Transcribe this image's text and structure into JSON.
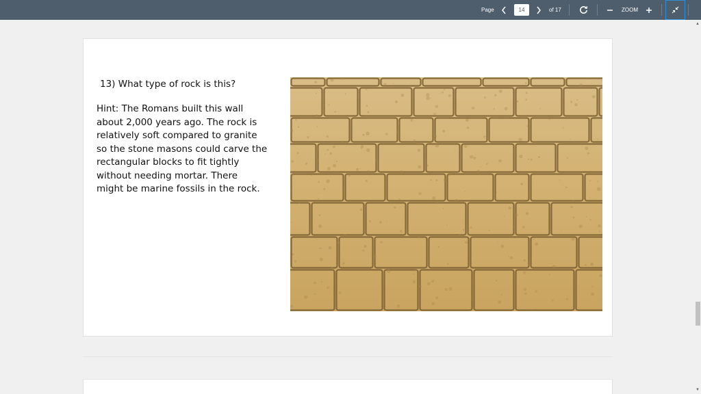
{
  "toolbar": {
    "page_label": "Page",
    "current_page": "14",
    "total_label": "of 17",
    "zoom_label": "ZOOM"
  },
  "slide": {
    "question": "13) What type of rock is this?",
    "hint_lines": [
      "Hint: The Romans built this wall",
      "about 2,000 years ago.  The rock is",
      "relatively soft compared to granite",
      "so the stone masons could carve the",
      "rectangular blocks to fit tightly",
      "without needing mortar. There",
      "might be marine fossils in the rock."
    ],
    "image_subject": "roman-limestone-wall"
  },
  "icons": {
    "prev": "chevron-left-icon",
    "next": "chevron-right-icon",
    "rotate": "rotate-icon",
    "zoom_out": "minus-icon",
    "zoom_in": "plus-icon",
    "fullscreen": "exit-fullscreen-icon"
  },
  "colors": {
    "toolbar_bg": "#4f5e6d",
    "accent": "#2e8fd8",
    "stone": "#d4b57c"
  }
}
